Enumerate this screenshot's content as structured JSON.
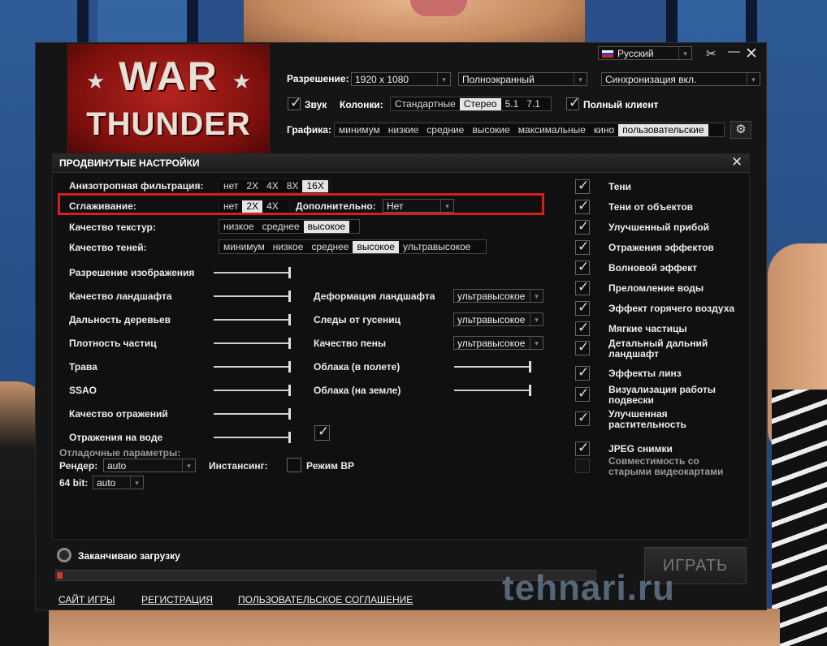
{
  "window": {
    "language": "Русский",
    "logo": {
      "line1": "WAR",
      "line2": "THUNDER"
    },
    "top": {
      "resolution_label": "Разрешение:",
      "resolution_value": "1920 x 1080",
      "window_mode": "Полноэкранный",
      "vsync": "Синхронизация вкл.",
      "sound_label": "Звук",
      "speakers_label": "Колонки:",
      "speakers_options": [
        "Стандартные",
        "Стерео",
        "5.1",
        "7.1"
      ],
      "speakers_selected": "Стерео",
      "full_client_label": "Полный клиент",
      "graphics_label": "Графика:",
      "graphics_options": [
        "минимум",
        "низкие",
        "средние",
        "высокие",
        "максимальные",
        "кино",
        "пользовательские"
      ],
      "graphics_selected": "пользовательские"
    },
    "advanced": {
      "title": "ПРОДВИНУТЫЕ НАСТРОЙКИ",
      "anisotropic_label": "Анизотропная фильтрация:",
      "anisotropic_options": [
        "нет",
        "2X",
        "4X",
        "8X",
        "16X"
      ],
      "anisotropic_selected": "16X",
      "aa_label": "Сглаживание:",
      "aa_options": [
        "нет",
        "2X",
        "4X"
      ],
      "aa_selected": "2X",
      "aa_extra_label": "Дополнительно:",
      "aa_extra_value": "Нет",
      "texture_label": "Качество текстур:",
      "texture_options": [
        "низкое",
        "среднее",
        "высокое"
      ],
      "texture_selected": "высокое",
      "shadow_label": "Качество теней:",
      "shadow_options": [
        "минимум",
        "низкое",
        "среднее",
        "высокое",
        "ультравысокое"
      ],
      "shadow_selected": "высокое",
      "sliders_left": [
        {
          "label": "Разрешение изображения",
          "level": 1.0
        },
        {
          "label": "Качество ландшафта",
          "level": 1.0
        },
        {
          "label": "Дальность деревьев",
          "level": 1.0
        },
        {
          "label": "Плотность частиц",
          "level": 1.0
        },
        {
          "label": "Трава",
          "level": 1.0
        },
        {
          "label": "SSAO",
          "level": 1.0
        },
        {
          "label": "Качество отражений",
          "level": 1.0
        },
        {
          "label": "Отражения на воде",
          "level": 1.0
        }
      ],
      "mid": {
        "terrain_deform_label": "Деформация ландшафта",
        "terrain_deform_value": "ультравысокое",
        "tracks_label": "Следы от гусениц",
        "tracks_value": "ультравысокое",
        "foam_label": "Качество пены",
        "foam_value": "ультравысокое",
        "clouds_flight_label": "Облака (в полете)",
        "clouds_flight_level": 1.0,
        "clouds_ground_label": "Облака (на земле)",
        "clouds_ground_level": 1.0
      },
      "debug_label": "Отладочные параметры:",
      "render_label": "Рендер:",
      "render_value": "auto",
      "instancing_label": "Инстансинг:",
      "vr_label": "Режим ВР",
      "bit64_label": "64 bit:",
      "bit64_value": "auto",
      "checks_right": [
        {
          "label": "Тени",
          "checked": true
        },
        {
          "label": "Тени от объектов",
          "checked": true
        },
        {
          "label": "Улучшенный прибой",
          "checked": true
        },
        {
          "label": "Отражения эффектов",
          "checked": true
        },
        {
          "label": "Волновой эффект",
          "checked": true
        },
        {
          "label": "Преломление воды",
          "checked": true
        },
        {
          "label": "Эффект горячего воздуха",
          "checked": true
        },
        {
          "label": "Мягкие частицы",
          "checked": true
        },
        {
          "label": "Детальный дальний ландшафт",
          "checked": true
        },
        {
          "label": "Эффекты линз",
          "checked": true
        },
        {
          "label": "Визуализация работы подвески",
          "checked": true
        },
        {
          "label": "Улучшенная растительность",
          "checked": true
        },
        {
          "label": "JPEG снимки",
          "checked": true
        },
        {
          "label": "Совместимость со старыми видеокартами",
          "checked": false
        }
      ]
    },
    "status_text": "Заканчиваю загрузку",
    "progress": 0.01,
    "play_label": "ИГРАТЬ",
    "links": [
      "САЙТ ИГРЫ",
      "РЕГИСТРАЦИЯ",
      "ПОЛЬЗОВАТЕЛЬСКОЕ СОГЛАШЕНИЕ"
    ]
  },
  "watermark": "tehnari.ru",
  "colors": {
    "accent_red": "#d81d1d",
    "window_bg": "#151515",
    "selected_bg": "#e4e4e4"
  }
}
